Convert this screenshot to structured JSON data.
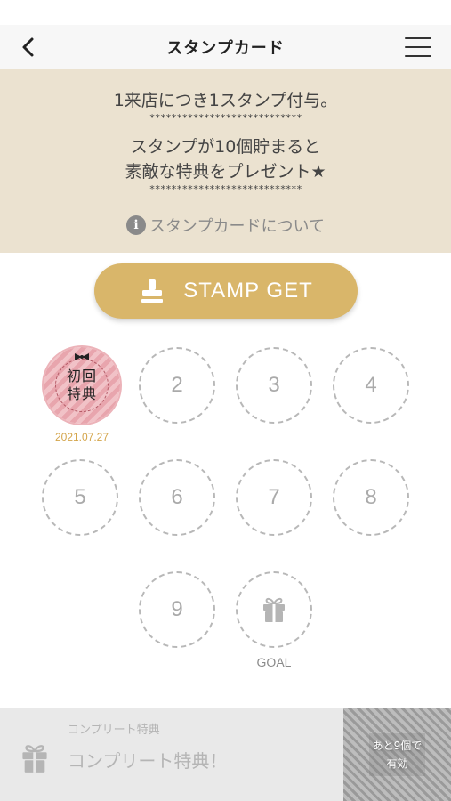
{
  "header": {
    "title": "スタンプカード",
    "back_icon": "chevron-left-icon",
    "menu_icon": "hamburger-menu-icon"
  },
  "info": {
    "line1": "1来店につき1スタンプ付与。",
    "stars1": "****************************",
    "line2": "スタンプが10個貯まると",
    "line3": "素敵な特典をプレゼント★",
    "stars2": "****************************",
    "about_label": "スタンプカードについて"
  },
  "stamp_button": {
    "label": "STAMP GET",
    "icon": "stamp-icon"
  },
  "stamps": {
    "first": {
      "line1": "初回",
      "line2": "特典",
      "date": "2021.07.27"
    },
    "slots": [
      "2",
      "3",
      "4",
      "5",
      "6",
      "7",
      "8",
      "9"
    ],
    "goal_label": "GOAL"
  },
  "complete": {
    "small_label": "コンプリート特典",
    "title": "コンプリート特典！",
    "remaining_line1": "あと9個で",
    "remaining_line2": "有効"
  },
  "colors": {
    "accent": "#d9b66a",
    "info_bg": "#ebe2d0",
    "date": "#d4a54b"
  }
}
